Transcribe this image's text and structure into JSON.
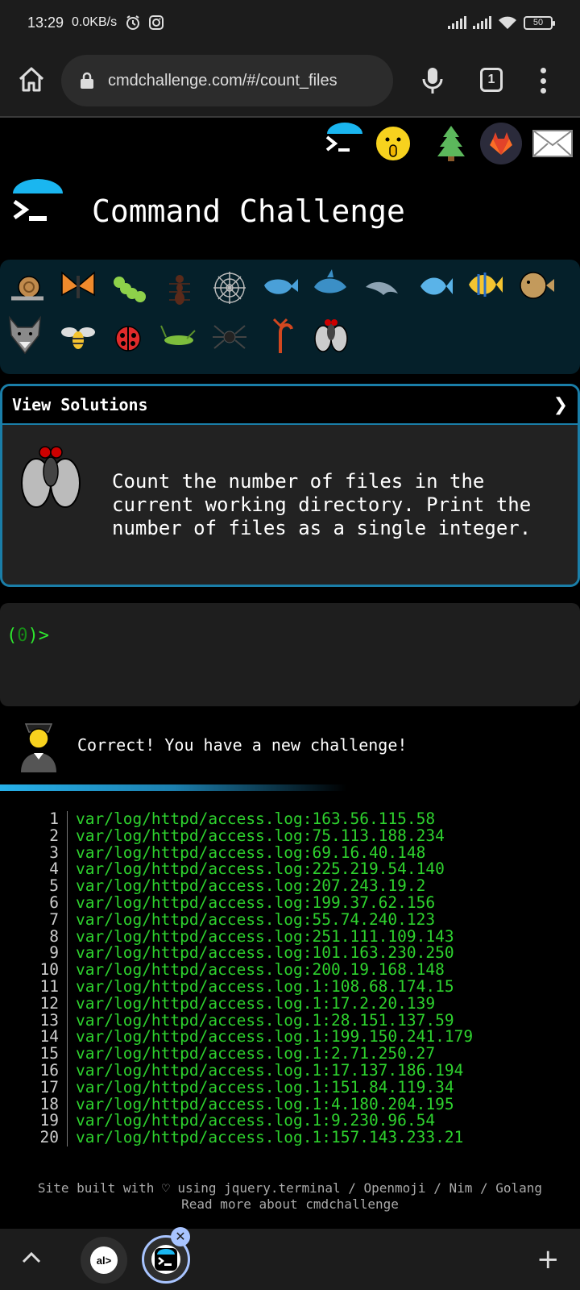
{
  "status_bar": {
    "time": "13:29",
    "net_speed": "0.0KB/s",
    "battery": "50"
  },
  "browser": {
    "url": "cmdchallenge.com/#/count_files",
    "tab_count": "1"
  },
  "header_icons": [
    "terminal-logo-icon",
    "shushing-face-icon",
    "christmas-tree-icon",
    "gitlab-icon",
    "envelope-icon"
  ],
  "title": "Command Challenge",
  "levels": [
    "snail",
    "butterfly",
    "caterpillar",
    "ant",
    "spider-web",
    "whale",
    "shark",
    "dolphin",
    "fish",
    "tropical-fish",
    "pufferfish",
    "wolf",
    "bee",
    "ladybug",
    "cricket",
    "spider",
    "scorpion",
    "fly"
  ],
  "challenge": {
    "view_solutions": "View Solutions",
    "chevron": "❯",
    "description": "Count the number of files in the current working directory. Print the number of files as a single integer."
  },
  "terminal": {
    "prompt_open": "(",
    "prompt_count": "0",
    "prompt_close": ")>"
  },
  "feedback": "Correct! You have a new challenge!",
  "output_lines": [
    {
      "n": "1",
      "t": "var/log/httpd/access.log:163.56.115.58"
    },
    {
      "n": "2",
      "t": "var/log/httpd/access.log:75.113.188.234"
    },
    {
      "n": "3",
      "t": "var/log/httpd/access.log:69.16.40.148"
    },
    {
      "n": "4",
      "t": "var/log/httpd/access.log:225.219.54.140"
    },
    {
      "n": "5",
      "t": "var/log/httpd/access.log:207.243.19.2"
    },
    {
      "n": "6",
      "t": "var/log/httpd/access.log:199.37.62.156"
    },
    {
      "n": "7",
      "t": "var/log/httpd/access.log:55.74.240.123"
    },
    {
      "n": "8",
      "t": "var/log/httpd/access.log:251.111.109.143"
    },
    {
      "n": "9",
      "t": "var/log/httpd/access.log:101.163.230.250"
    },
    {
      "n": "10",
      "t": "var/log/httpd/access.log:200.19.168.148"
    },
    {
      "n": "11",
      "t": "var/log/httpd/access.log.1:108.68.174.15"
    },
    {
      "n": "12",
      "t": "var/log/httpd/access.log.1:17.2.20.139"
    },
    {
      "n": "13",
      "t": "var/log/httpd/access.log.1:28.151.137.59"
    },
    {
      "n": "14",
      "t": "var/log/httpd/access.log.1:199.150.241.179"
    },
    {
      "n": "15",
      "t": "var/log/httpd/access.log.1:2.71.250.27"
    },
    {
      "n": "16",
      "t": "var/log/httpd/access.log.1:17.137.186.194"
    },
    {
      "n": "17",
      "t": "var/log/httpd/access.log.1:151.84.119.34"
    },
    {
      "n": "18",
      "t": "var/log/httpd/access.log.1:4.180.204.195"
    },
    {
      "n": "19",
      "t": "var/log/httpd/access.log.1:9.230.96.54"
    },
    {
      "n": "20",
      "t": "var/log/httpd/access.log.1:157.143.233.21"
    }
  ],
  "footer": {
    "line1": "Site built with ♡ using jquery.terminal / Openmoji / Nim / Golang",
    "line2": "Read more about cmdchallenge"
  },
  "bottom_nav": {
    "alx_label": "al>",
    "close_glyph": "✕",
    "plus_glyph": "+"
  },
  "colors": {
    "accent": "#1a7ea8",
    "terminal_green": "#2ed22e",
    "panel_bg": "#05202a"
  }
}
